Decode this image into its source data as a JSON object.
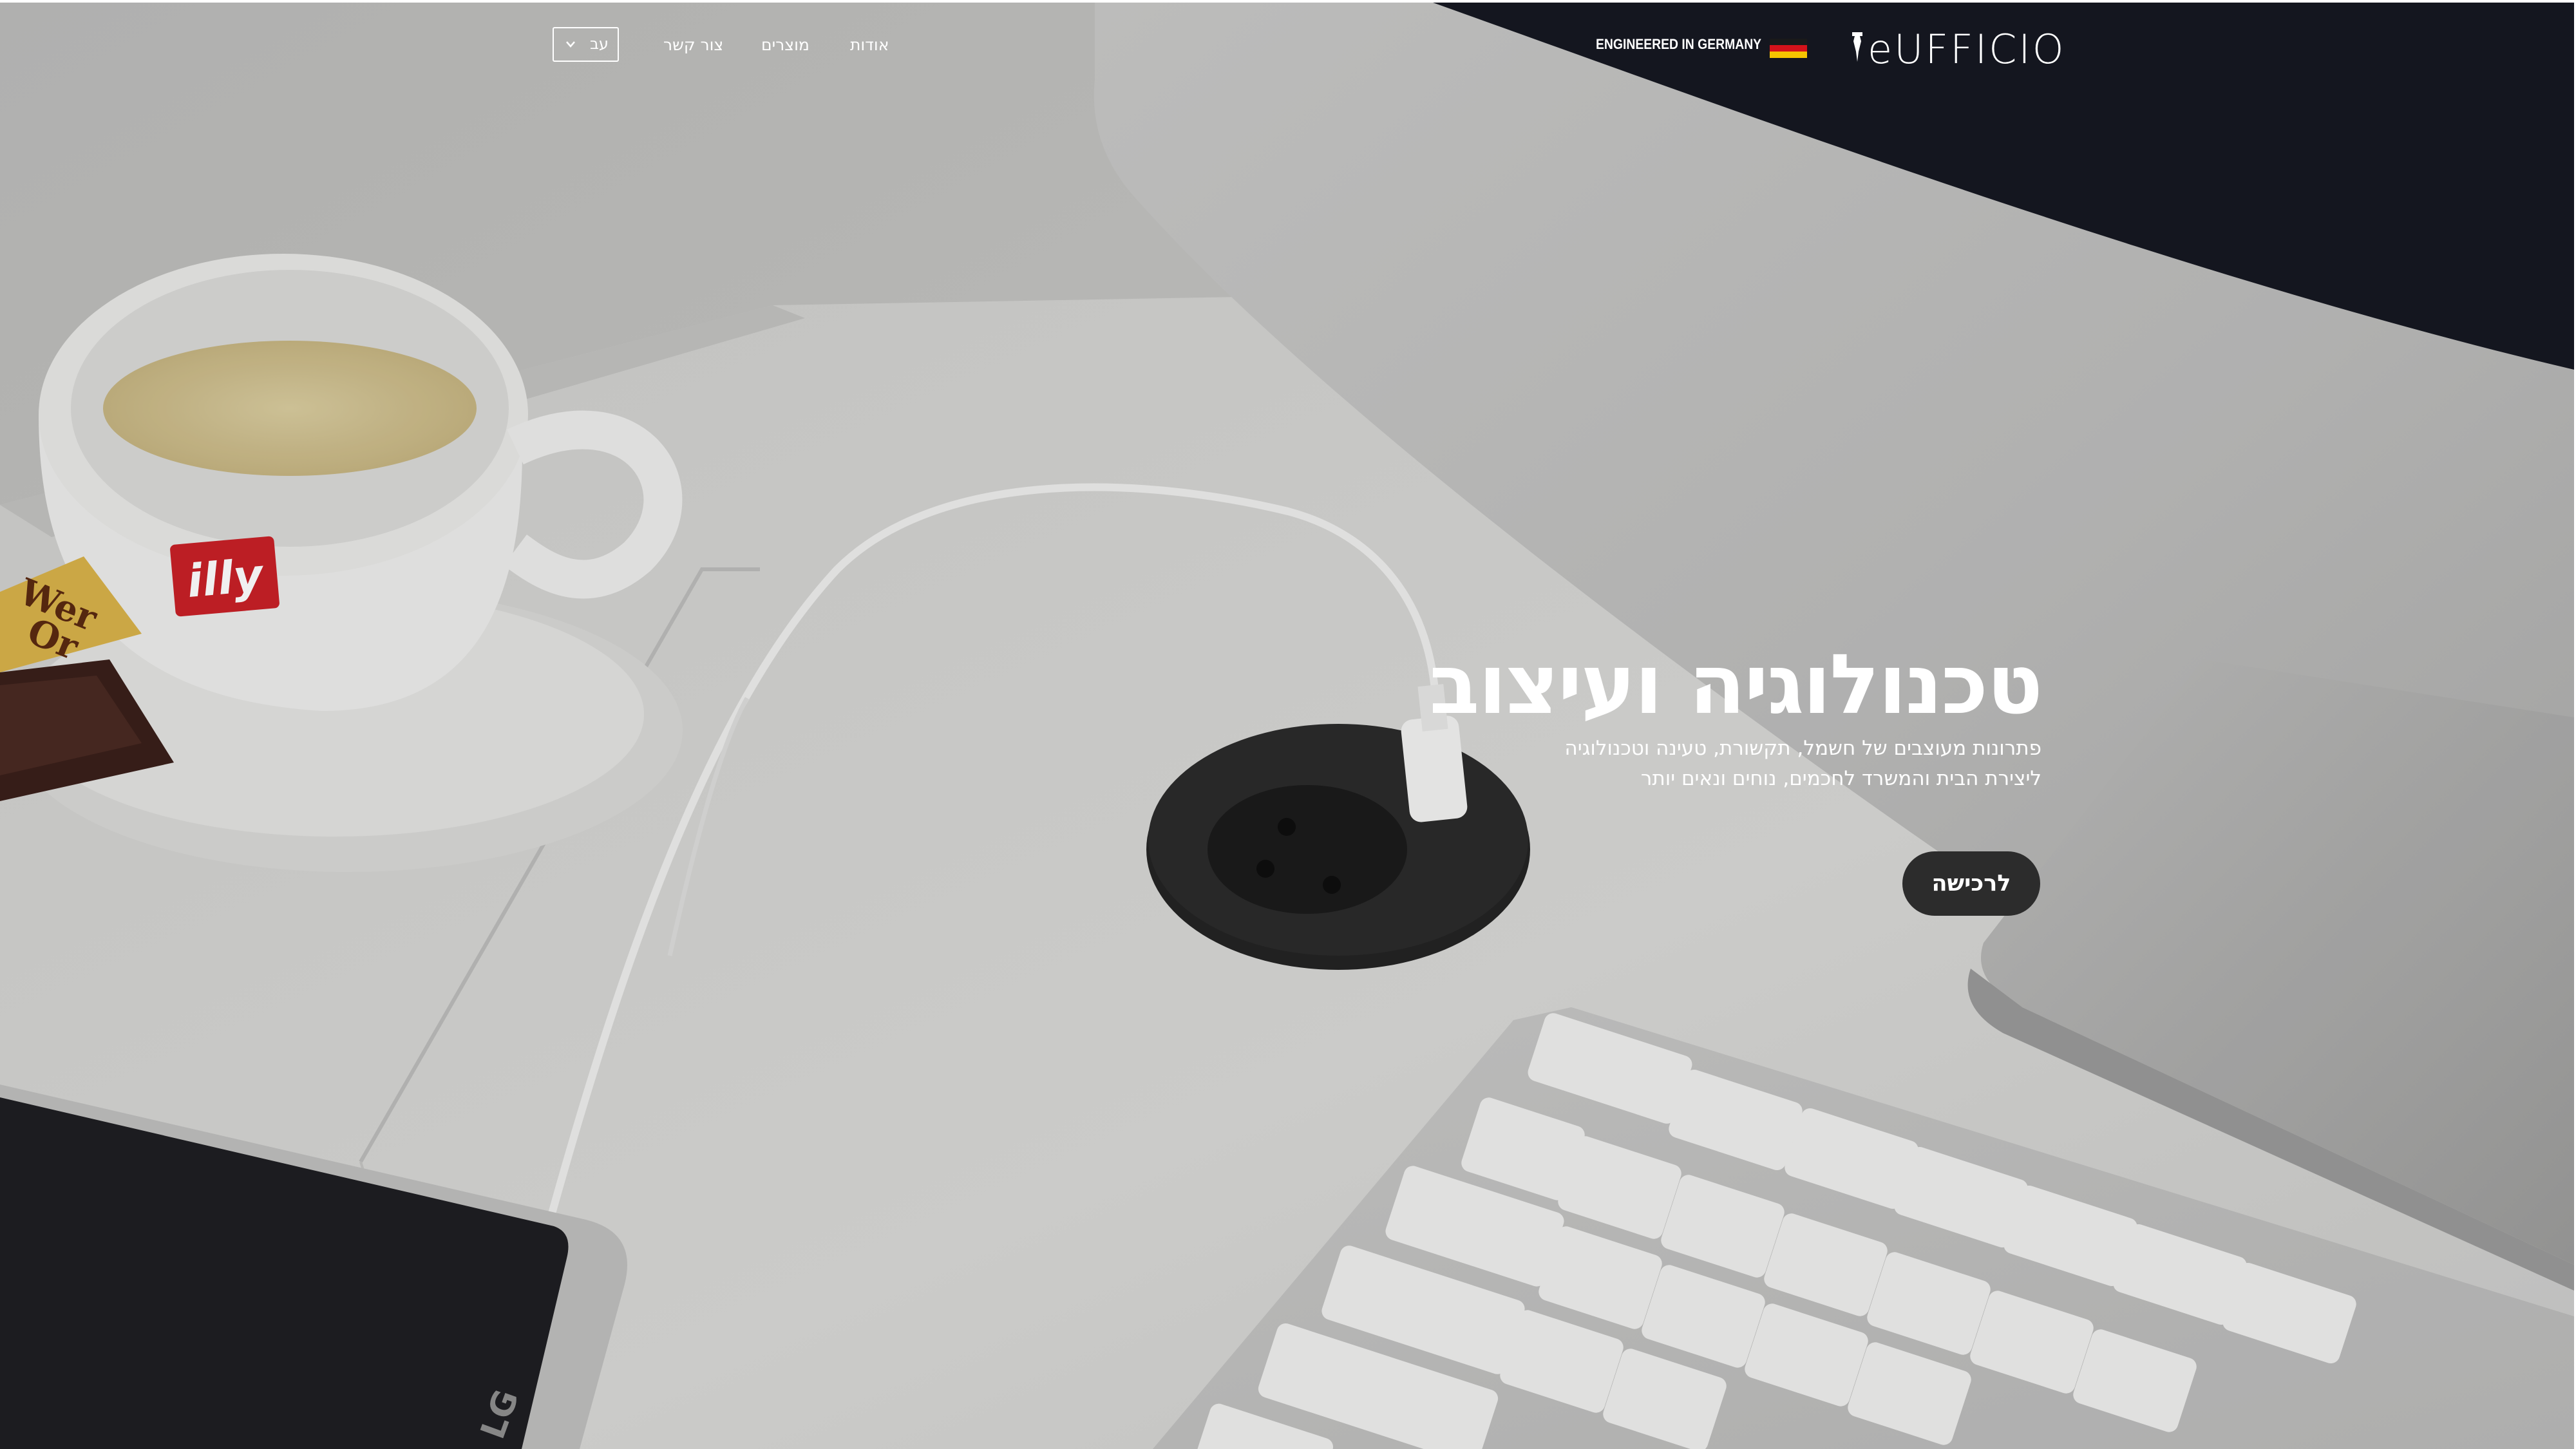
{
  "brand": {
    "name": "eUFFICIO",
    "tagline": "ENGINEERED IN GERMANY"
  },
  "flag_colors": [
    "#1a1a1a",
    "#d4121a",
    "#f5c400"
  ],
  "nav": {
    "about": "אודות",
    "products": "מוצרים",
    "contact": "צור קשר"
  },
  "language": {
    "selected": "עב"
  },
  "hero": {
    "title": "טכנולוגיה ועיצוב",
    "subtitle_line1": "פתרונות מעוצבים של חשמל, תקשורת, טעינה וטכנולוגיה",
    "subtitle_line2": "ליצירת הבית והמשרד לחכמים, נוחים ונאים יותר",
    "cta": "לרכישה"
  },
  "photo_text": {
    "cup_logo": "illy",
    "candy_wrapper": "Werther's Original",
    "phone_logo": "LG"
  },
  "colors": {
    "cta_bg": "#2c2c2c",
    "text": "#ffffff"
  }
}
